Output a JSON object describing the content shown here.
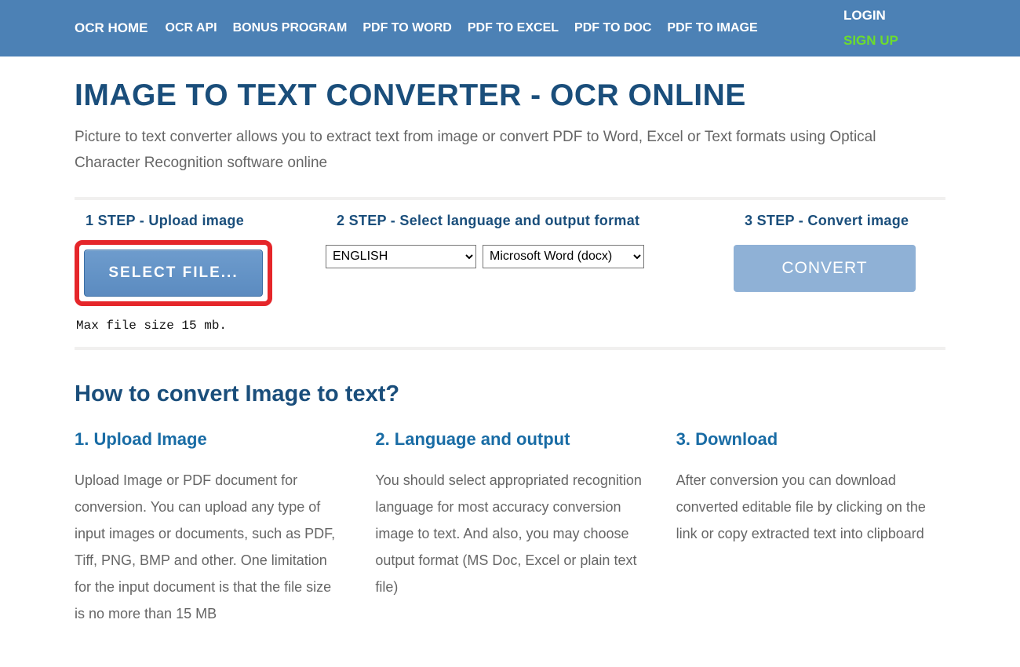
{
  "nav": {
    "home": "OCR HOME",
    "links": [
      "OCR API",
      "BONUS PROGRAM",
      "PDF TO WORD",
      "PDF TO EXCEL",
      "PDF TO DOC",
      "PDF TO IMAGE"
    ],
    "login": "LOGIN",
    "signup": "SIGN UP"
  },
  "header": {
    "title": "IMAGE TO TEXT CONVERTER - OCR ONLINE",
    "subtitle": "Picture to text converter allows you to extract text from image or convert PDF to Word, Excel or Text formats using Optical Character Recognition software online"
  },
  "steps": {
    "s1_title": "1 STEP - Upload image",
    "select_file_label": "SELECT FILE...",
    "max_size": "Max file size 15 mb.",
    "s2_title": "2 STEP - Select language and output format",
    "lang_selected": "ENGLISH",
    "format_selected": "Microsoft Word (docx)",
    "s3_title": "3 STEP - Convert image",
    "convert_label": "CONVERT"
  },
  "howto": {
    "heading": "How to convert Image to text?",
    "cols": [
      {
        "title": "1. Upload Image",
        "body": "Upload Image or PDF document for conversion. You can upload any type of input images or documents, such as PDF, Tiff, PNG, BMP and other. One limitation for the input document is that the file size is no more than 15 MB"
      },
      {
        "title": "2. Language and output",
        "body": "You should select appropriated recognition language for most accuracy conversion image to text. And also, you may choose output format (MS Doc, Excel or plain text file)"
      },
      {
        "title": "3. Download",
        "body": "After conversion you can download converted editable file by clicking on the link or copy extracted text into clipboard"
      }
    ]
  }
}
